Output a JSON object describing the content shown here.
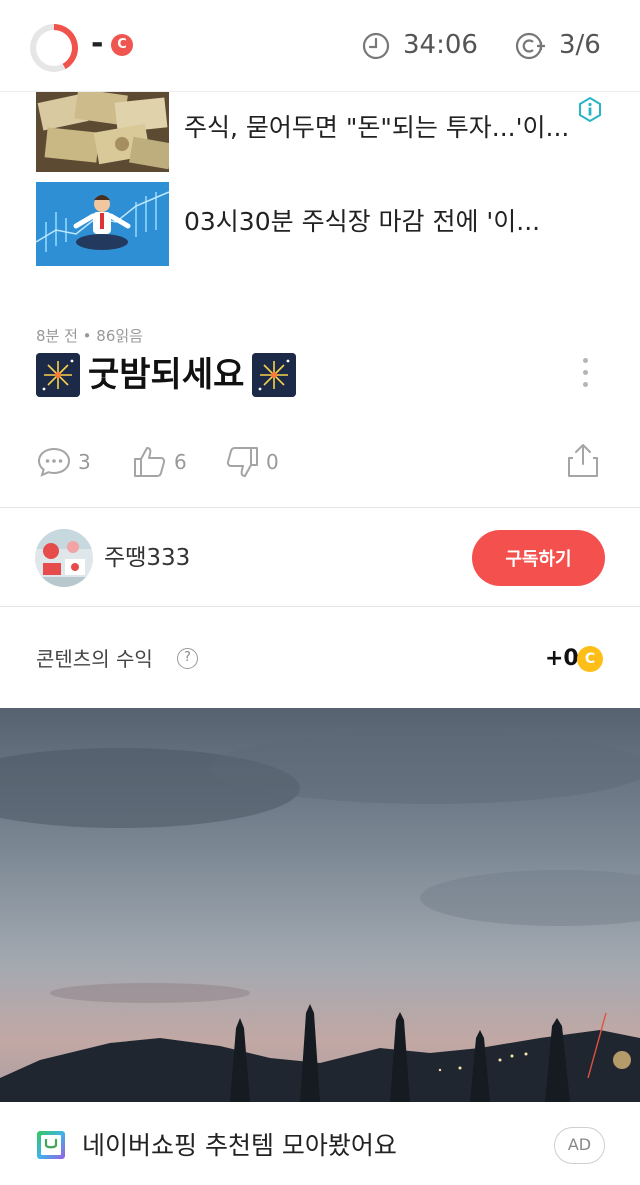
{
  "topbar": {
    "progress_fraction": 0.42,
    "points_value": "-",
    "coin_letter": "C",
    "timer": "34:06",
    "count": "3/6",
    "accent_red": "#f0534b"
  },
  "related_articles": [
    {
      "title": "주식, 묻어두면 \"돈\"되는 투자...'이..."
    },
    {
      "title": "03시30분 주식장 마감 전에 '이..."
    }
  ],
  "post": {
    "meta": "8분 전 • 86읽음",
    "title": "굿밤되세요",
    "comments": "3",
    "likes": "6",
    "dislikes": "0"
  },
  "author": {
    "name": "주땡333",
    "subscribe_label": "구독하기",
    "subscribe_color": "#f4504d"
  },
  "earnings": {
    "label": "콘텐츠의 수익",
    "help": "?",
    "value": "+0",
    "coin_letter": "C",
    "coin_color": "#fdbf17"
  },
  "ad": {
    "text": "네이버쇼핑 추천템 모아봤어요",
    "badge": "AD"
  }
}
